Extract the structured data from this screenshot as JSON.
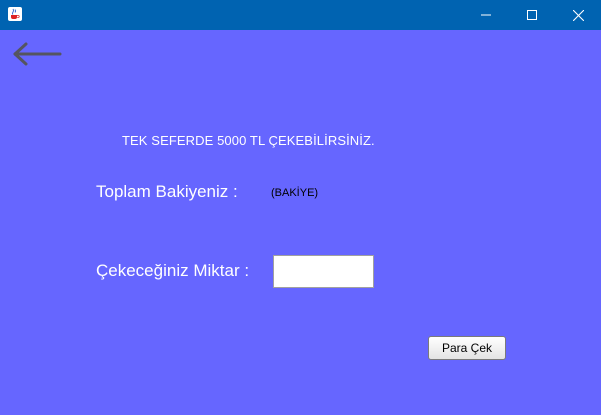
{
  "window": {
    "icons": {
      "app": "java-cup-icon",
      "minimize": "minimize-icon",
      "maximize": "maximize-icon",
      "close": "close-icon"
    },
    "colors": {
      "titlebar": "#0063b1",
      "background": "#6666ff"
    }
  },
  "nav": {
    "back_icon": "back-arrow-icon"
  },
  "form": {
    "info_text": "TEK SEFERDE 5000 TL ÇEKEBİLİRSİNİZ.",
    "balance_label": "Toplam Bakiyeniz :",
    "balance_value": "(BAKİYE)",
    "amount_label": "Çekeceğiniz Miktar :",
    "amount_value": "",
    "withdraw_button": "Para Çek"
  }
}
